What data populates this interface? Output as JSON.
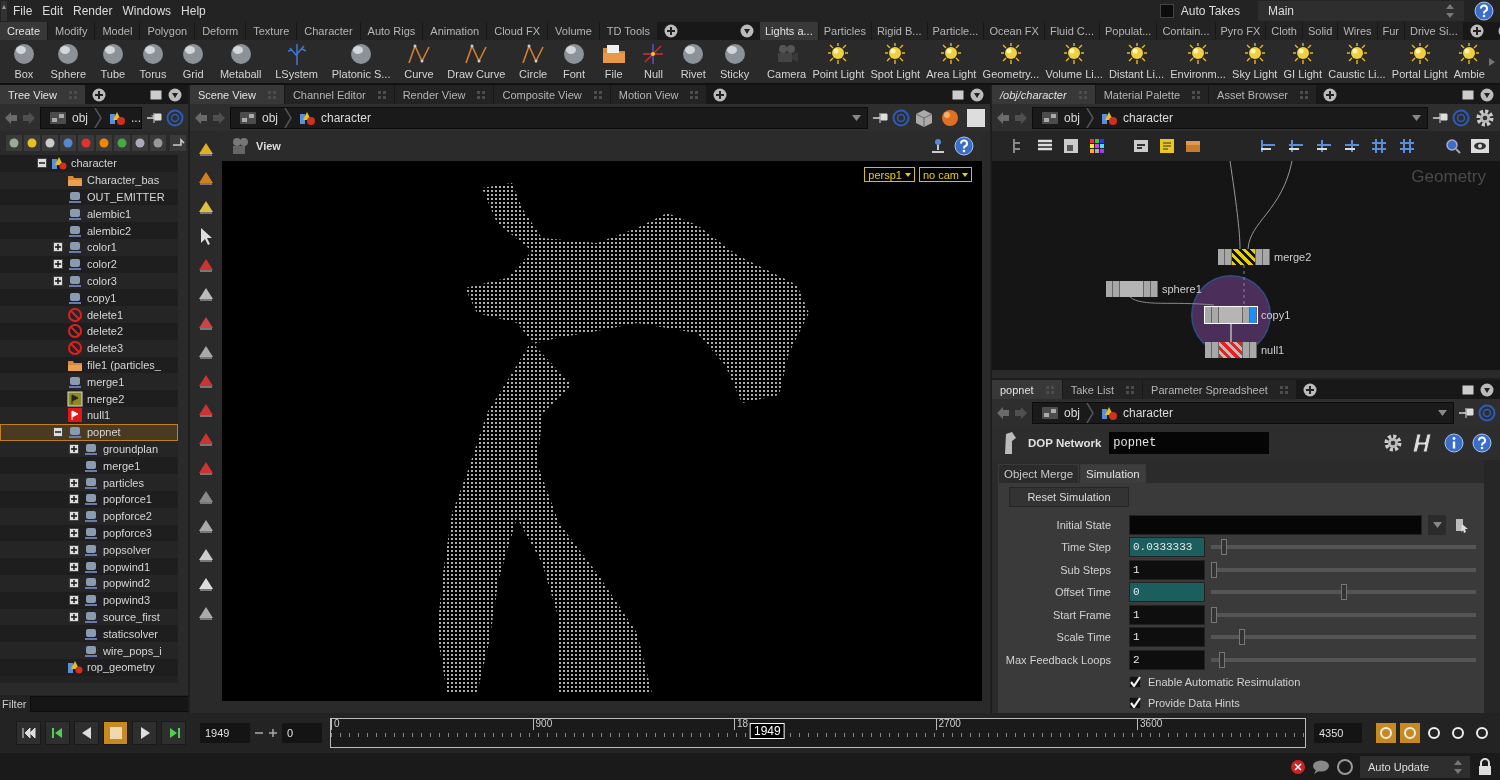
{
  "menu": [
    "File",
    "Edit",
    "Render",
    "Windows",
    "Help"
  ],
  "auto_takes": {
    "label": "Auto Takes",
    "checked": false
  },
  "desktop": {
    "value": "Main"
  },
  "shelves": [
    {
      "tabs": [
        {
          "label": "Create",
          "selected": true
        },
        {
          "label": "Modify",
          "selected": false
        },
        {
          "label": "Model",
          "selected": false
        },
        {
          "label": "Polygon",
          "selected": false
        },
        {
          "label": "Deform",
          "selected": false
        },
        {
          "label": "Texture",
          "selected": false
        },
        {
          "label": "Character",
          "selected": false
        },
        {
          "label": "Auto Rigs",
          "selected": false
        },
        {
          "label": "Animation",
          "selected": false
        },
        {
          "label": "Cloud FX",
          "selected": false
        },
        {
          "label": "Volume",
          "selected": false
        },
        {
          "label": "TD Tools",
          "selected": false
        }
      ],
      "tools": [
        {
          "label": "Box",
          "kind": "shape"
        },
        {
          "label": "Sphere",
          "kind": "shape"
        },
        {
          "label": "Tube",
          "kind": "shape"
        },
        {
          "label": "Torus",
          "kind": "shape"
        },
        {
          "label": "Grid",
          "kind": "shape"
        },
        {
          "label": "Metaball",
          "kind": "shape"
        },
        {
          "label": "LSystem",
          "kind": "branch"
        },
        {
          "label": "Platonic S...",
          "kind": "shape"
        },
        {
          "label": "Curve",
          "kind": "curve"
        },
        {
          "label": "Draw Curve",
          "kind": "curve"
        },
        {
          "label": "Circle",
          "kind": "curve"
        },
        {
          "label": "Font",
          "kind": "shape"
        },
        {
          "label": "File",
          "kind": "file"
        },
        {
          "label": "Null",
          "kind": "axes"
        },
        {
          "label": "Rivet",
          "kind": "shape"
        },
        {
          "label": "Sticky",
          "kind": "shape"
        }
      ]
    },
    {
      "tabs": [
        {
          "label": "Lights a...",
          "selected": true
        },
        {
          "label": "Particles",
          "selected": false
        },
        {
          "label": "Rigid B...",
          "selected": false
        },
        {
          "label": "Particle...",
          "selected": false
        },
        {
          "label": "Ocean FX",
          "selected": false
        },
        {
          "label": "Fluid C...",
          "selected": false
        },
        {
          "label": "Populat...",
          "selected": false
        },
        {
          "label": "Contain...",
          "selected": false
        },
        {
          "label": "Pyro FX",
          "selected": false
        },
        {
          "label": "Cloth",
          "selected": false
        },
        {
          "label": "Solid",
          "selected": false
        },
        {
          "label": "Wires",
          "selected": false
        },
        {
          "label": "Fur",
          "selected": false
        },
        {
          "label": "Drive Si...",
          "selected": false
        }
      ],
      "tools": [
        {
          "label": "Camera",
          "kind": "camera"
        },
        {
          "label": "Point Light",
          "kind": "light"
        },
        {
          "label": "Spot Light",
          "kind": "light"
        },
        {
          "label": "Area Light",
          "kind": "light"
        },
        {
          "label": "Geometry...",
          "kind": "light"
        },
        {
          "label": "Volume Li...",
          "kind": "light"
        },
        {
          "label": "Distant Li...",
          "kind": "light"
        },
        {
          "label": "Environm...",
          "kind": "light"
        },
        {
          "label": "Sky Light",
          "kind": "light"
        },
        {
          "label": "GI Light",
          "kind": "light"
        },
        {
          "label": "Caustic Li...",
          "kind": "light"
        },
        {
          "label": "Portal Light",
          "kind": "light"
        },
        {
          "label": "Ambie",
          "kind": "light"
        }
      ]
    }
  ],
  "tree_view": {
    "tabs": [
      {
        "label": "Tree View",
        "selected": true
      }
    ],
    "path": [
      "obj",
      "..."
    ],
    "items": [
      {
        "label": "character",
        "kind": "object",
        "expanded": true,
        "selected": false,
        "children": [
          {
            "label": "Character_bas",
            "kind": "file",
            "selected": false
          },
          {
            "label": "OUT_EMITTER",
            "kind": "node",
            "selected": false
          },
          {
            "label": "alembic1",
            "kind": "node",
            "selected": false
          },
          {
            "label": "alembic2",
            "kind": "node",
            "selected": false
          },
          {
            "label": "color1",
            "kind": "node",
            "expanded": false,
            "selected": false
          },
          {
            "label": "color2",
            "kind": "node",
            "expanded": false,
            "selected": false
          },
          {
            "label": "color3",
            "kind": "node",
            "expanded": false,
            "selected": false
          },
          {
            "label": "copy1",
            "kind": "node",
            "selected": false
          },
          {
            "label": "delete1",
            "kind": "delete",
            "selected": false
          },
          {
            "label": "delete2",
            "kind": "delete",
            "selected": false
          },
          {
            "label": "delete3",
            "kind": "delete",
            "selected": false
          },
          {
            "label": "file1 (particles_",
            "kind": "file",
            "selected": false
          },
          {
            "label": "merge1",
            "kind": "node",
            "selected": false
          },
          {
            "label": "merge2",
            "kind": "merge",
            "selected": false
          },
          {
            "label": "null1",
            "kind": "null",
            "selected": false
          },
          {
            "label": "popnet",
            "kind": "node",
            "expanded": true,
            "selected": true,
            "children": [
              {
                "label": "groundplan",
                "kind": "node",
                "expanded": false,
                "selected": false
              },
              {
                "label": "merge1",
                "kind": "node",
                "selected": false
              },
              {
                "label": "particles",
                "kind": "node",
                "expanded": false,
                "selected": false
              },
              {
                "label": "popforce1",
                "kind": "node",
                "expanded": false,
                "selected": false
              },
              {
                "label": "popforce2",
                "kind": "node",
                "expanded": false,
                "selected": false
              },
              {
                "label": "popforce3",
                "kind": "node",
                "expanded": false,
                "selected": false
              },
              {
                "label": "popsolver",
                "kind": "node",
                "expanded": false,
                "selected": false
              },
              {
                "label": "popwind1",
                "kind": "node",
                "expanded": false,
                "selected": false
              },
              {
                "label": "popwind2",
                "kind": "node",
                "expanded": false,
                "selected": false
              },
              {
                "label": "popwind3",
                "kind": "node",
                "expanded": false,
                "selected": false
              },
              {
                "label": "source_first",
                "kind": "node",
                "expanded": false,
                "selected": false
              },
              {
                "label": "staticsolver",
                "kind": "node",
                "selected": false
              },
              {
                "label": "wire_pops_i",
                "kind": "node",
                "selected": false
              }
            ]
          },
          {
            "label": "rop_geometry",
            "kind": "object",
            "selected": false
          }
        ]
      }
    ],
    "filter": {
      "label": "Filter"
    }
  },
  "scene_view": {
    "tabs": [
      {
        "label": "Scene View",
        "selected": true
      },
      {
        "label": "Channel Editor",
        "selected": false
      },
      {
        "label": "Render View",
        "selected": false
      },
      {
        "label": "Composite View",
        "selected": false
      },
      {
        "label": "Motion View",
        "selected": false
      }
    ],
    "path": [
      "obj",
      "character"
    ],
    "title": "View",
    "camera_menus": [
      "persp1",
      "no cam"
    ]
  },
  "network_view": {
    "tabs": [
      {
        "label": "/obj/character",
        "selected": true
      },
      {
        "label": "Material Palette",
        "selected": false
      },
      {
        "label": "Asset Browser",
        "selected": false
      }
    ],
    "path": [
      "obj",
      "character"
    ],
    "context": "Geometry",
    "nodes": [
      {
        "name": "merge2",
        "kind": "bypass",
        "selected": false
      },
      {
        "name": "sphere1",
        "kind": "plain",
        "selected": false
      },
      {
        "name": "copy1",
        "kind": "display",
        "selected": true
      },
      {
        "name": "null1",
        "kind": "lock",
        "selected": false
      }
    ]
  },
  "parameters": {
    "tabs": [
      {
        "label": "popnet",
        "selected": true
      },
      {
        "label": "Take List",
        "selected": false
      },
      {
        "label": "Parameter Spreadsheet",
        "selected": false
      }
    ],
    "path": [
      "obj",
      "character"
    ],
    "node_type": "DOP Network",
    "node_name": "popnet",
    "folders": [
      {
        "label": "Object Merge",
        "selected": false
      },
      {
        "label": "Simulation",
        "selected": true
      }
    ],
    "button": "Reset Simulation",
    "rows": [
      {
        "label": "Initial State",
        "kind": "menu"
      },
      {
        "label": "Time Step",
        "kind": "slider",
        "value": "0.0333333",
        "highlighted": true,
        "level": 0.04
      },
      {
        "label": "Sub Steps",
        "kind": "slider",
        "value": "1",
        "highlighted": false,
        "level": 0
      },
      {
        "label": "Offset Time",
        "kind": "slider",
        "value": "0",
        "highlighted": true,
        "level": 0.5
      },
      {
        "label": "Start Frame",
        "kind": "slider",
        "value": "1",
        "highlighted": false,
        "level": 0
      },
      {
        "label": "Scale Time",
        "kind": "slider",
        "value": "1",
        "highlighted": false,
        "level": 0.11
      },
      {
        "label": "Max Feedback Loops",
        "kind": "slider",
        "value": "2",
        "highlighted": false,
        "level": 0.03
      }
    ],
    "checkboxes": [
      {
        "label": "Enable Automatic Resimulation",
        "checked": true
      },
      {
        "label": "Provide Data Hints",
        "checked": true
      }
    ]
  },
  "timeline": {
    "playback": [
      {
        "kind": "jump_start",
        "selected": false
      },
      {
        "kind": "step_back",
        "selected": false
      },
      {
        "kind": "play_reverse",
        "selected": false
      },
      {
        "kind": "stop",
        "selected": true
      },
      {
        "kind": "play_forward",
        "selected": false
      },
      {
        "kind": "step_forward",
        "selected": false
      }
    ],
    "frame": "1949",
    "start": "0",
    "ticks": [
      "0",
      "900",
      "18",
      "2700",
      "3600"
    ],
    "current": "1949",
    "level": 0.448,
    "end": "4350"
  },
  "status_bar": {
    "update_mode": "Auto Update"
  }
}
